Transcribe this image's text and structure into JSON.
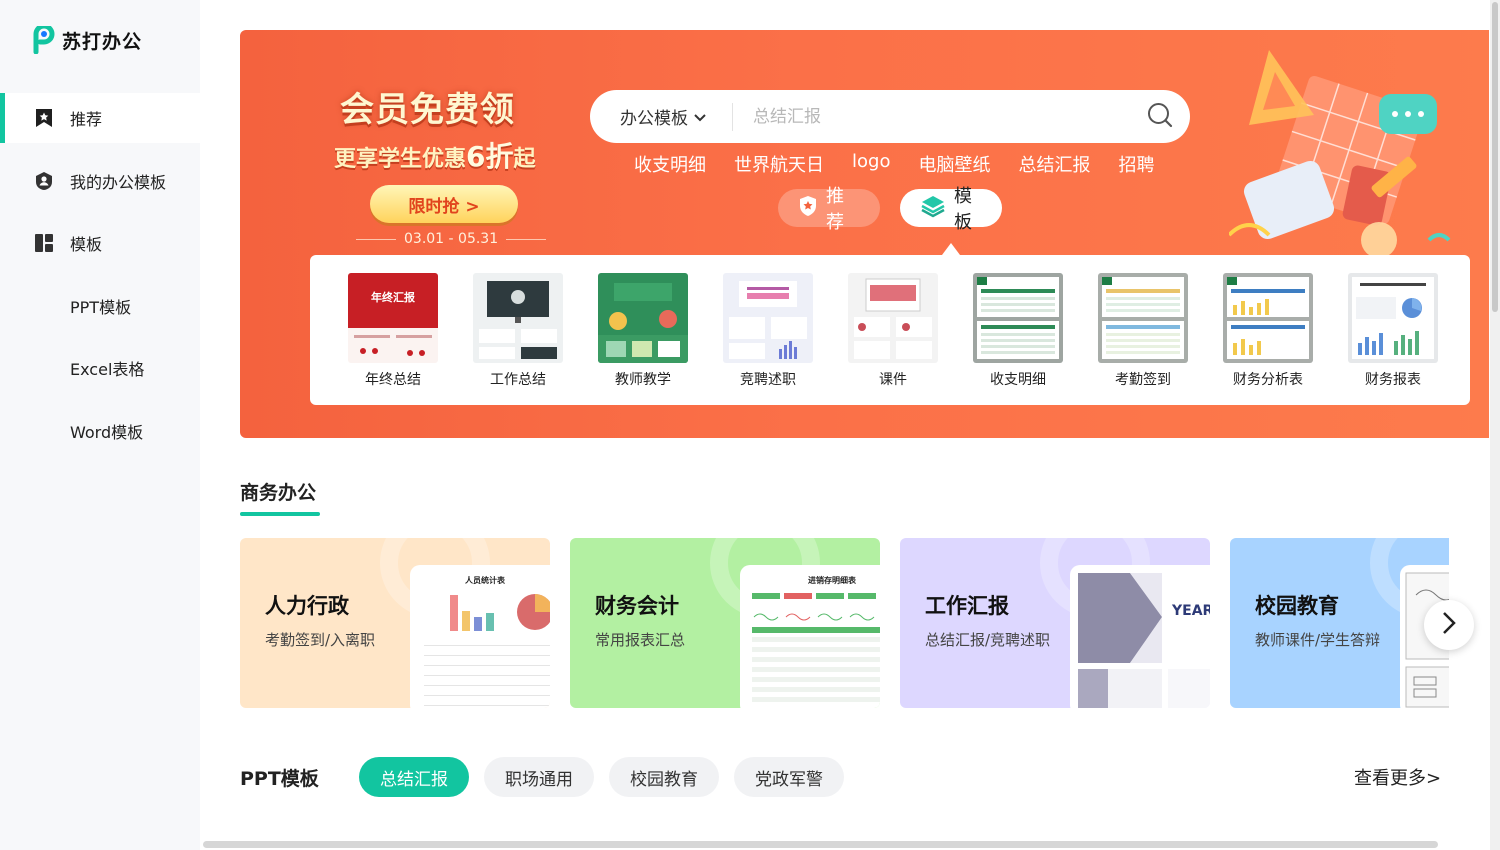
{
  "app": {
    "logo_text": "苏打办公",
    "brand_color": "#12c5a0"
  },
  "sidebar": {
    "items": [
      {
        "label": "推荐",
        "icon": "star-bookmark-icon"
      },
      {
        "label": "我的办公模板",
        "icon": "user-shield-icon"
      },
      {
        "label": "模板",
        "icon": "grid-layout-icon"
      },
      {
        "label": "PPT模板"
      },
      {
        "label": "Excel表格"
      },
      {
        "label": "Word模板"
      }
    ]
  },
  "banner": {
    "promo_title": "会员免费领",
    "promo_sub_prefix": "更享学生优惠",
    "promo_sub_highlight": "6折",
    "promo_sub_suffix": "起",
    "promo_button": "限时抢 >",
    "promo_date": "03.01 - 05.31",
    "search_category": "办公模板",
    "search_placeholder": "总结汇报",
    "hot_words": [
      "收支明细",
      "世界航天日",
      "logo",
      "电脑壁纸",
      "总结汇报",
      "招聘"
    ],
    "pill_recommend": "推荐",
    "pill_template": "模板",
    "categories": [
      "年终总结",
      "工作总结",
      "教师教学",
      "竞聘述职",
      "课件",
      "收支明细",
      "考勤签到",
      "财务分析表",
      "财务报表"
    ],
    "thumb_year_title": "年终汇报"
  },
  "business": {
    "title": "商务办公",
    "cards": [
      {
        "title": "人力行政",
        "subtitle": "考勤签到/入离职",
        "sheet_title": "人员统计表"
      },
      {
        "title": "财务会计",
        "subtitle": "常用报表汇总",
        "sheet_title": "进销存明细表"
      },
      {
        "title": "工作汇报",
        "subtitle": "总结汇报/竞聘述职",
        "sheet_title": "YEAR-RE"
      },
      {
        "title": "校园教育",
        "subtitle": "教师课件/学生答辩",
        "sheet_title": ""
      }
    ]
  },
  "ppt": {
    "title": "PPT模板",
    "tabs": [
      "总结汇报",
      "职场通用",
      "校园教育",
      "党政军警"
    ],
    "more": "查看更多>"
  }
}
